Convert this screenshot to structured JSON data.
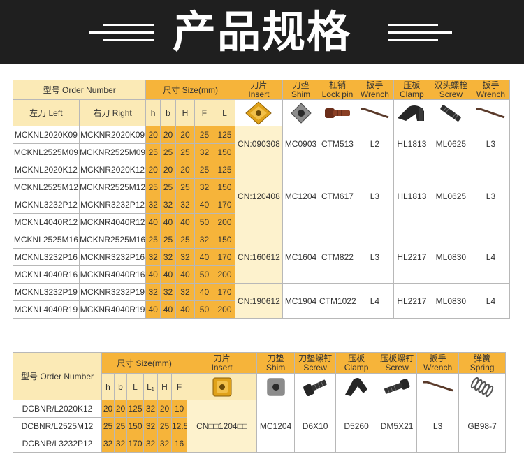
{
  "banner": {
    "title": "产品规格"
  },
  "table1": {
    "headers": {
      "model": "型号 Order Number",
      "size": "尺寸 Size(mm)",
      "left": "左刀 Left",
      "right": "右刀 Right",
      "dims": [
        "h",
        "b",
        "H",
        "F",
        "L"
      ],
      "insert_cn": "刀片",
      "insert_en": "Insert",
      "shim_cn": "刀垫",
      "shim_en": "Shim",
      "lockpin_cn": "杠销",
      "lockpin_en": "Lock pin",
      "wrench_cn": "扳手",
      "wrench_en": "Wrench",
      "clamp_cn": "压板",
      "clamp_en": "Clamp",
      "screw_cn": "双头螺栓",
      "screw_en": "Screw",
      "wrench2_cn": "扳手",
      "wrench2_en": "Wrench"
    },
    "rows": [
      [
        "MCKNL2020K09",
        "MCKNR2020K09",
        "20",
        "20",
        "20",
        "25",
        "125"
      ],
      [
        "MCKNL2525M09",
        "MCKNR2525M09",
        "25",
        "25",
        "25",
        "32",
        "150"
      ],
      [
        "MCKNL2020K12",
        "MCKNR2020K12",
        "20",
        "20",
        "20",
        "25",
        "125"
      ],
      [
        "MCKNL2525M12",
        "MCKNR2525M12",
        "25",
        "25",
        "25",
        "32",
        "150"
      ],
      [
        "MCKNL3232P12",
        "MCKNR3232P12",
        "32",
        "32",
        "32",
        "40",
        "170"
      ],
      [
        "MCKNL4040R12",
        "MCKNR4040R12",
        "40",
        "40",
        "40",
        "50",
        "200"
      ],
      [
        "MCKNL2525M16",
        "MCKNR2525M16",
        "25",
        "25",
        "25",
        "32",
        "150"
      ],
      [
        "MCKNL3232P16",
        "MCKNR3232P16",
        "32",
        "32",
        "32",
        "40",
        "170"
      ],
      [
        "MCKNL4040R16",
        "MCKNR4040R16",
        "40",
        "40",
        "40",
        "50",
        "200"
      ],
      [
        "MCKNL3232P19",
        "MCKNR3232P19",
        "32",
        "32",
        "32",
        "40",
        "170"
      ],
      [
        "MCKNL4040R19",
        "MCKNR4040R19",
        "40",
        "40",
        "40",
        "50",
        "200"
      ]
    ],
    "groups": [
      {
        "insert": "CN:090308",
        "shim": "MC0903",
        "lockpin": "CTM513",
        "wrench": "L2",
        "clamp": "HL1813",
        "screw": "ML0625",
        "wrench2": "L3"
      },
      {
        "insert": "CN:120408",
        "shim": "MC1204",
        "lockpin": "CTM617",
        "wrench": "L3",
        "clamp": "HL1813",
        "screw": "ML0625",
        "wrench2": "L3"
      },
      {
        "insert": "CN:160612",
        "shim": "MC1604",
        "lockpin": "CTM822",
        "wrench": "L3",
        "clamp": "HL2217",
        "screw": "ML0830",
        "wrench2": "L4"
      },
      {
        "insert": "CN:190612",
        "shim": "MC1904",
        "lockpin": "CTM1022",
        "wrench": "L4",
        "clamp": "HL2217",
        "screw": "ML0830",
        "wrench2": "L4"
      }
    ]
  },
  "table2": {
    "headers": {
      "model": "型号 Order Number",
      "size": "尺寸 Size(mm)",
      "dims": [
        "h",
        "b",
        "L",
        "L₁",
        "H",
        "F"
      ],
      "insert_cn": "刀片",
      "insert_en": "Insert",
      "shim_cn": "刀垫",
      "shim_en": "Shim",
      "shimscrew_cn": "刀垫螺钉",
      "shimscrew_en": "Screw",
      "clamp_cn": "压板",
      "clamp_en": "Clamp",
      "clampscrew_cn": "压板螺钉",
      "clampscrew_en": "Screw",
      "wrench_cn": "扳手",
      "wrench_en": "Wrench",
      "spring_cn": "弹簧",
      "spring_en": "Spring"
    },
    "rows": [
      [
        "DCBNR/L2020K12",
        "20",
        "20",
        "125",
        "32",
        "20",
        "10"
      ],
      [
        "DCBNR/L2525M12",
        "25",
        "25",
        "150",
        "32",
        "25",
        "12.5"
      ],
      [
        "DCBNR/L3232P12",
        "32",
        "32",
        "170",
        "32",
        "32",
        "16"
      ]
    ],
    "parts": {
      "insert": "CN□□1204□□",
      "shim": "MC1204",
      "shimscrew": "D6X10",
      "clamp": "D5260",
      "clampscrew": "DM5X21",
      "wrench": "L3",
      "spring": "GB98-7"
    }
  },
  "colors": {
    "header_orange": "#f6b43a",
    "header_cream": "#fbeab6",
    "insert_gold": "#e0a21a",
    "banner": "#1f1f1f"
  }
}
